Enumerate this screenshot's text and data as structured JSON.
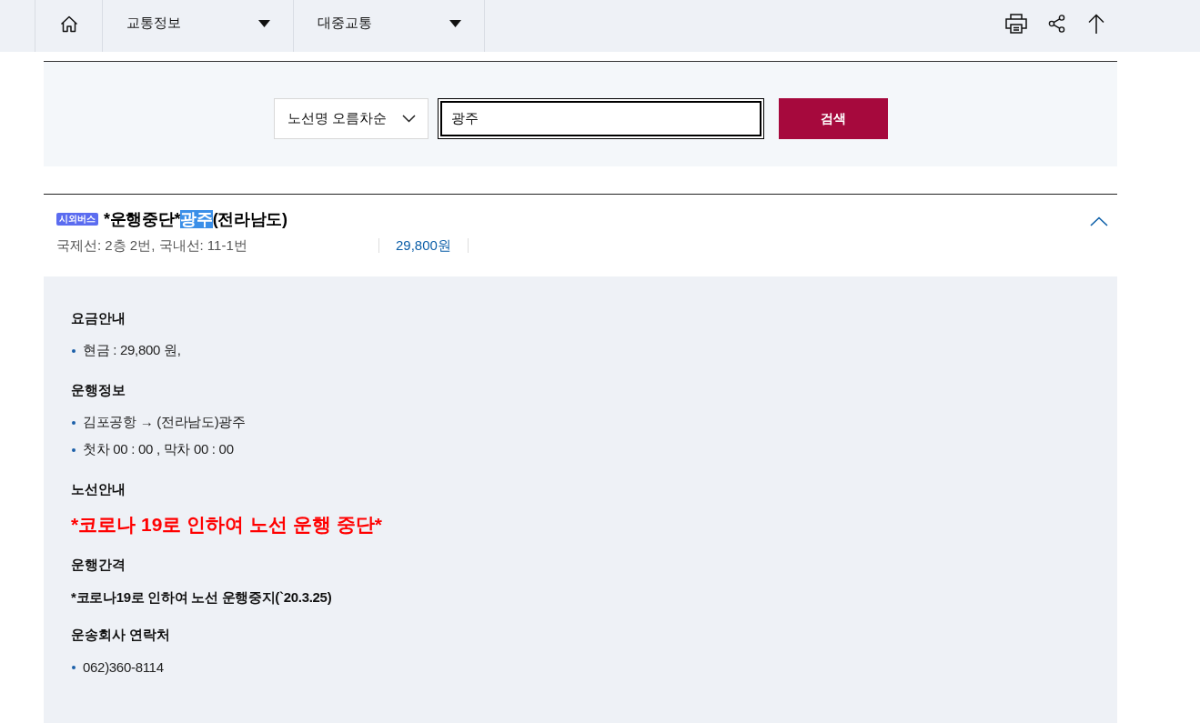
{
  "nav": {
    "menus": [
      {
        "label": "교통정보"
      },
      {
        "label": "대중교통"
      }
    ]
  },
  "search": {
    "sort": "노선명 오름차순",
    "query": "광주",
    "focused": true,
    "button": "검색"
  },
  "result": {
    "category": "시외버스",
    "title": [
      {
        "text": "*운행중단*",
        "highlighted": false
      },
      {
        "text": "광주",
        "highlighted": true
      },
      {
        "text": "(전라남도)",
        "highlighted": false
      }
    ],
    "boarding": "국제선: 2층 2번, 국내선: 11-1번",
    "fare": "29,800원",
    "expanded": true,
    "sections": [
      {
        "heading": "요금안내",
        "kind": "bullets",
        "items": [
          "현금 : 29,800 원,"
        ]
      },
      {
        "heading": "운행정보",
        "kind": "bullets",
        "items": [
          "김포공항 → (전라남도)광주",
          "첫차 00 : 00 , 막차 00 : 00"
        ]
      },
      {
        "heading": "노선안내",
        "kind": "notice",
        "text": "*코로나 19로 인하여 노선 운행 중단*"
      },
      {
        "heading": "운행간격",
        "kind": "text",
        "text": "*코로나19로 인하여 노선 운행중지(`20.3.25)"
      },
      {
        "heading": "운송회사 연락처",
        "kind": "bullets",
        "items": [
          "062)360-8114"
        ]
      }
    ]
  }
}
